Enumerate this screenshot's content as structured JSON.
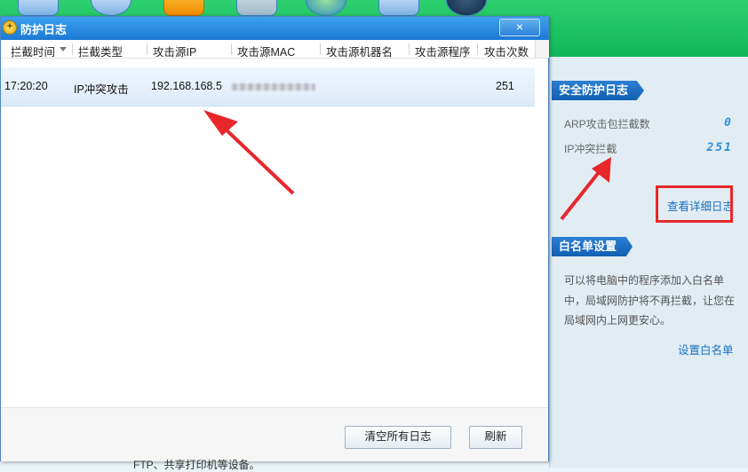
{
  "dialog": {
    "title": "防护日志",
    "close_label": "×",
    "columns": [
      "拦截时间",
      "拦截类型",
      "攻击源IP",
      "攻击源MAC",
      "攻击源机器名",
      "攻击源程序",
      "攻击次数"
    ],
    "row": {
      "time": "17:20:20",
      "type": "IP冲突攻击",
      "ip": "192.168.168.5",
      "machine": "",
      "program": "",
      "count": "251"
    },
    "buttons": {
      "clear_all": "清空所有日志",
      "refresh": "刷新"
    }
  },
  "right_panel": {
    "security_log": {
      "header": "安全防护日志",
      "arp_label": "ARP攻击包拦截数",
      "arp_value": "0",
      "ip_label": "IP冲突拦截",
      "ip_value": "251",
      "detail_link": "查看详细日志"
    },
    "whitelist": {
      "header": "白名单设置",
      "description": "可以将电脑中的程序添加入白名单中，局域网防护将不再拦截，让您在局域网内上网更安心。",
      "set_link": "设置白名单"
    }
  },
  "footer_text": "FTP、共享打印机等设备。",
  "colors": {
    "accent": "#1c79d5",
    "annotation": "#e8272b",
    "app_green": "#12b65a"
  },
  "icons": [
    "app-tool-icon-1",
    "heartbeat-icon",
    "lightning-shield-icon",
    "firewall-icon",
    "globe-icon",
    "network-icon",
    "speedometer-icon",
    "shield-plus-icon"
  ]
}
